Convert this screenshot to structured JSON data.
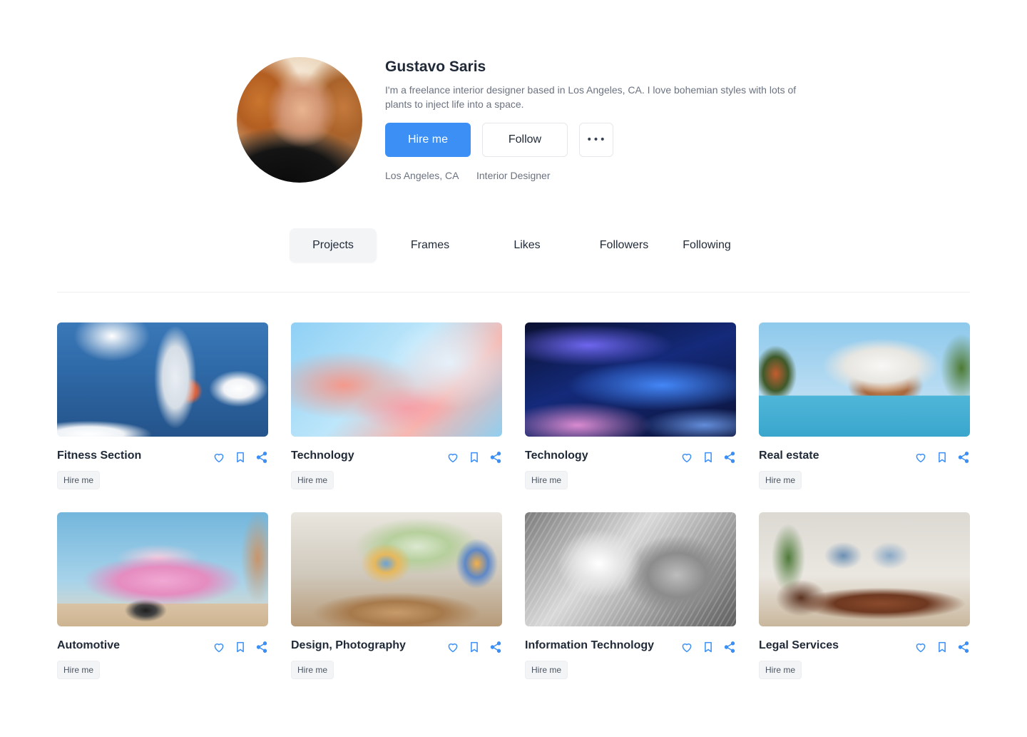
{
  "profile": {
    "name": "Gustavo Saris",
    "bio": "I'm a freelance interior designer based in Los Angeles, CA. I love bohemian styles with lots of plants to inject life into a space.",
    "hire_label": "Hire me",
    "follow_label": "Follow",
    "more_label": "•••",
    "location": "Los Angeles, CA",
    "role": "Interior Designer"
  },
  "tabs": [
    {
      "label": "Projects",
      "active": true
    },
    {
      "label": "Frames",
      "active": false
    },
    {
      "label": "Likes",
      "active": false
    },
    {
      "label": "Followers",
      "active": false
    },
    {
      "label": "Following",
      "active": false
    }
  ],
  "projects": [
    {
      "title": "Fitness Section",
      "tag": "Hire me"
    },
    {
      "title": "Technology",
      "tag": "Hire me"
    },
    {
      "title": "Technology",
      "tag": "Hire me"
    },
    {
      "title": "Real estate",
      "tag": "Hire me"
    },
    {
      "title": "Automotive",
      "tag": "Hire me"
    },
    {
      "title": "Design, Photography",
      "tag": "Hire me"
    },
    {
      "title": "Information Technology",
      "tag": "Hire me"
    },
    {
      "title": "Legal Services",
      "tag": "Hire me"
    }
  ],
  "colors": {
    "accent": "#3b8ff5",
    "icon": "#3b8ff5",
    "text": "#1f2937",
    "muted": "#6b7280",
    "tab_active_bg": "#f3f4f6"
  },
  "icons": {
    "like": "heart-icon",
    "save": "bookmark-icon",
    "share": "share-icon",
    "more": "more-dots-icon"
  }
}
